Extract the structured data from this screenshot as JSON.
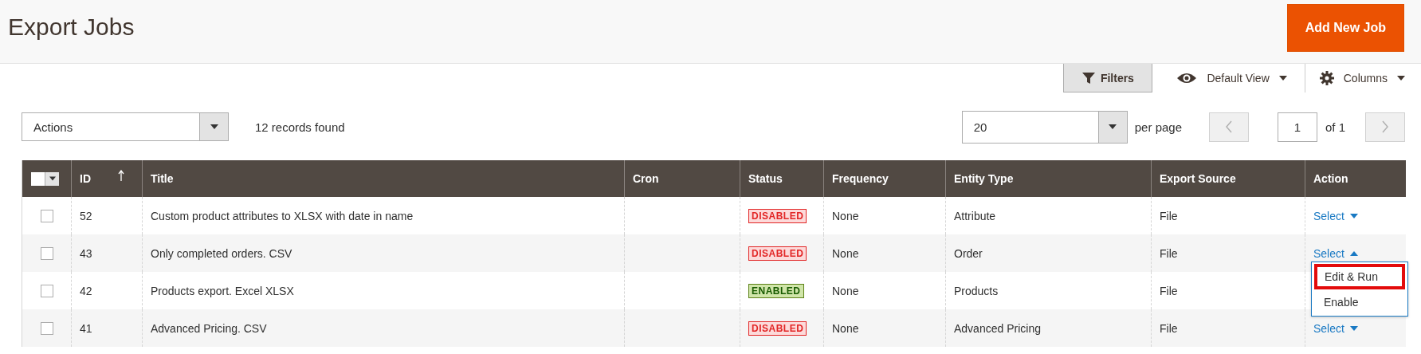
{
  "page": {
    "title": "Export Jobs",
    "primary_button": "Add New Job"
  },
  "toolbar": {
    "filters": "Filters",
    "view": "Default View",
    "columns": "Columns"
  },
  "actions": {
    "label": "Actions",
    "records": "12 records found"
  },
  "pager": {
    "per_page_value": "20",
    "per_page_label": "per page",
    "page": "1",
    "of": "of 1"
  },
  "table": {
    "mass_select": {
      "checked": false
    },
    "columns": [
      {
        "label": "ID",
        "sorted": true
      },
      {
        "label": "Title",
        "sorted": false
      },
      {
        "label": "Cron",
        "sorted": false
      },
      {
        "label": "Status",
        "sorted": false
      },
      {
        "label": "Frequency",
        "sorted": false
      },
      {
        "label": "Entity Type",
        "sorted": false
      },
      {
        "label": "Export Source",
        "sorted": false
      },
      {
        "label": "Action",
        "sorted": false
      }
    ],
    "rows": [
      {
        "checked": false,
        "id": "52",
        "title": "Custom product attributes to XLSX with date in name",
        "status": "DISABLED",
        "kind": "disabled",
        "frequency": "None",
        "entity": "Attribute",
        "source": "File",
        "action": "Select",
        "expanded": false
      },
      {
        "checked": false,
        "id": "43",
        "title": "Only completed orders. CSV",
        "status": "DISABLED",
        "kind": "disabled",
        "frequency": "None",
        "entity": "Order",
        "source": "File",
        "action": "Select",
        "expanded": true,
        "menu": [
          {
            "label": "Edit & Run",
            "highlighted": true
          },
          {
            "label": "Enable",
            "highlighted": false
          }
        ]
      },
      {
        "checked": false,
        "id": "42",
        "title": "Products export. Excel XLSX",
        "status": "ENABLED",
        "kind": "enabled",
        "frequency": "None",
        "entity": "Products",
        "source": "File"
      },
      {
        "checked": false,
        "id": "41",
        "title": "Advanced Pricing. CSV",
        "status": "DISABLED",
        "kind": "disabled",
        "frequency": "None",
        "entity": "Advanced Pricing",
        "source": "File",
        "action": "Select",
        "expanded": false
      }
    ]
  }
}
